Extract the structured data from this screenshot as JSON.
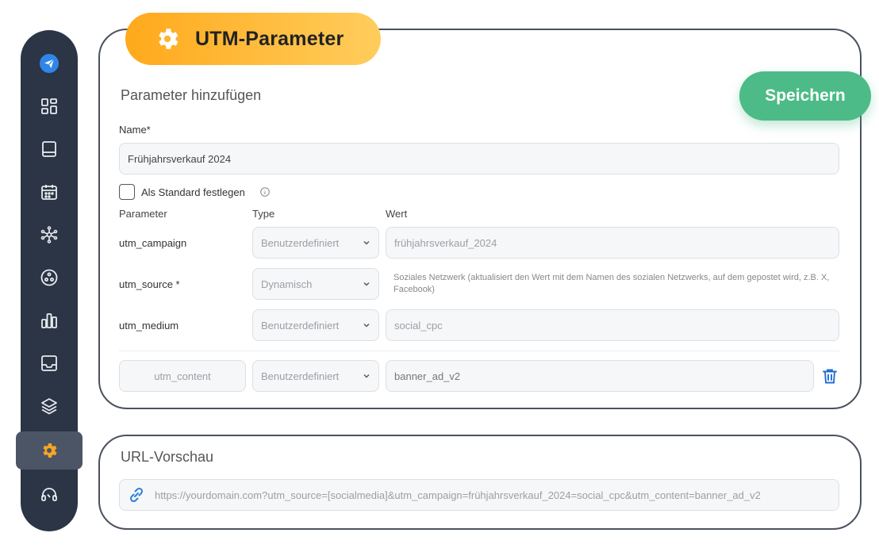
{
  "header": {
    "title": "UTM-Parameter",
    "icon": "gear-icon"
  },
  "toolbar": {
    "save_label": "Speichern"
  },
  "colors": {
    "accent": "#ffa91b",
    "save": "#4cbb87",
    "sidebar": "#2b3545",
    "active_icon": "#f5a623",
    "link": "#2f7fdc",
    "trash": "#1f6fd1"
  },
  "form": {
    "section_title": "Parameter hinzufügen",
    "name_label": "Name*",
    "name_value": "Frühjahrsverkauf 2024",
    "default_label": "Als Standard festlegen",
    "columns": {
      "parameter": "Parameter",
      "type": "Type",
      "value": "Wert"
    },
    "rows": [
      {
        "param": "utm_campaign",
        "type": "Benutzerdefiniert",
        "value": "frühjahrsverkauf_2024"
      },
      {
        "param": "utm_source *",
        "type": "Dynamisch",
        "hint": "Soziales Netzwerk (aktualisiert den Wert mit dem Namen des sozialen Netzwerks, auf dem gepostet wird, z.B. X, Facebook)"
      },
      {
        "param": "utm_medium",
        "type": "Benutzerdefiniert",
        "value": "social_cpc"
      },
      {
        "param": "utm_content",
        "type": "Benutzerdefiniert",
        "value": "banner_ad_v2"
      }
    ]
  },
  "preview": {
    "title": "URL-Vorschau",
    "url": "https://yourdomain.com?utm_source=[socialmedia]&utm_campaign=frühjahrsverkauf_2024=social_cpc&utm_content=banner_ad_v2"
  },
  "sidebar": {
    "items": [
      {
        "icon": "paper-plane-icon"
      },
      {
        "icon": "dashboard-icon"
      },
      {
        "icon": "book-icon"
      },
      {
        "icon": "calendar-icon"
      },
      {
        "icon": "network-icon"
      },
      {
        "icon": "circle-dots-icon"
      },
      {
        "icon": "bar-chart-icon"
      },
      {
        "icon": "inbox-icon"
      },
      {
        "icon": "layers-icon"
      },
      {
        "icon": "gear-icon",
        "active": true
      },
      {
        "icon": "headset-icon"
      }
    ]
  }
}
